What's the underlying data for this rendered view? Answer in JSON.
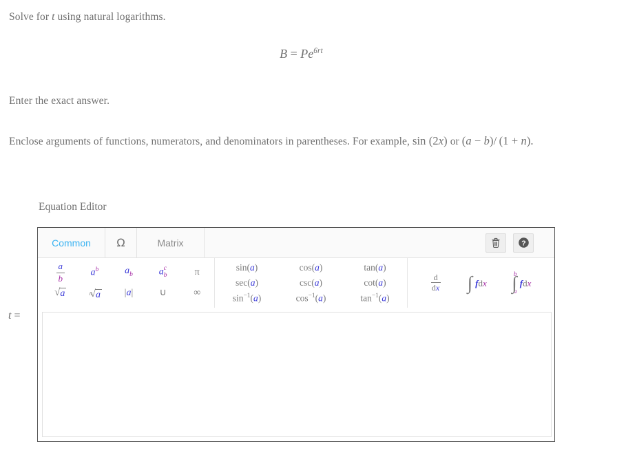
{
  "problem": {
    "line1_pre": "Solve for ",
    "line1_var": "t",
    "line1_post": " using natural logarithms.",
    "equation": {
      "lhs": "B",
      "eq": "=",
      "coef": "P",
      "base": "e",
      "exponent": "6rt",
      "full": "B = Pe^(6rt)"
    },
    "line2": "Enter the exact answer.",
    "line3_pre": "Enclose arguments of functions, numerators, and denominators in parentheses. For example, ",
    "line3_example1": "sin (2x)",
    "line3_mid": " or ",
    "line3_example2": "(a − b)/ (1 + n)."
  },
  "editor": {
    "title": "Equation Editor",
    "answer_label": "t =",
    "tabs": [
      {
        "label": "Common",
        "active": true
      },
      {
        "label": "Ω",
        "active": false
      },
      {
        "label": "Matrix",
        "active": false
      }
    ],
    "tools": [
      {
        "name": "trash-icon",
        "label": "Delete"
      },
      {
        "name": "help-icon",
        "label": "Help"
      }
    ],
    "palette": {
      "basic": [
        {
          "name": "fraction",
          "num": "a",
          "den": "b"
        },
        {
          "name": "superscript",
          "base": "a",
          "sup": "b"
        },
        {
          "name": "subscript",
          "base": "a",
          "sub": "b"
        },
        {
          "name": "subsuperscript",
          "base": "a",
          "sup": "c",
          "sub": "b"
        },
        {
          "name": "pi",
          "glyph": "π"
        },
        {
          "name": "square-root",
          "radicand": "a"
        },
        {
          "name": "nth-root",
          "index": "n",
          "radicand": "a"
        },
        {
          "name": "absolute-value",
          "arg": "a"
        },
        {
          "name": "union",
          "glyph": "∪"
        },
        {
          "name": "infinity",
          "glyph": "∞"
        }
      ],
      "trig": [
        {
          "name": "sin",
          "fn": "sin",
          "arg": "a"
        },
        {
          "name": "cos",
          "fn": "cos",
          "arg": "a"
        },
        {
          "name": "tan",
          "fn": "tan",
          "arg": "a"
        },
        {
          "name": "sec",
          "fn": "sec",
          "arg": "a"
        },
        {
          "name": "csc",
          "fn": "csc",
          "arg": "a"
        },
        {
          "name": "cot",
          "fn": "cot",
          "arg": "a"
        },
        {
          "name": "arcsin",
          "fn": "sin",
          "inv": "−1",
          "arg": "a"
        },
        {
          "name": "arccos",
          "fn": "cos",
          "inv": "−1",
          "arg": "a"
        },
        {
          "name": "arctan",
          "fn": "tan",
          "inv": "−1",
          "arg": "a"
        }
      ],
      "calculus": [
        {
          "name": "derivative",
          "num": "d",
          "den_d": "d",
          "den_x": "x"
        },
        {
          "name": "indefinite-integral",
          "f": "f",
          "d": "d",
          "x": "x"
        },
        {
          "name": "definite-integral",
          "upper": "b",
          "lower": "a",
          "f": "f",
          "d": "d",
          "x": "x"
        }
      ]
    },
    "answer_input": {
      "value": "",
      "placeholder": ""
    }
  },
  "colors": {
    "accent_blue": "#3ab3f2",
    "symbol_blue": "#3a39d8",
    "symbol_magenta": "#a52ba5",
    "text_gray": "#6f6f6f",
    "border_dark": "#555555",
    "border_light": "#e0e0e0"
  }
}
